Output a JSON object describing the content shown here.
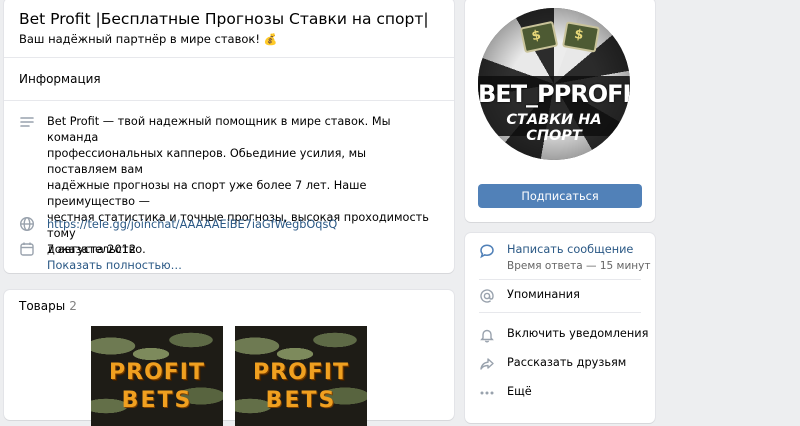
{
  "header": {
    "group_name": "Bet Profit |Бесплатные Прогнозы Ставки на спорт|",
    "status": "Ваш надёжный партнёр в мире ставок!",
    "status_emoji": "💰"
  },
  "info": {
    "section_title": "Информация",
    "description_lines": [
      "Bet Profit — твой надежный помощник в мире ставок. Мы команда",
      "профессиональных капперов. Обьединие усилия, мы поставляем вам",
      "надёжные прогнозы на спорт уже более 7 лет. Наше преимущество —",
      "честная статистика и точные прогнозы, высокая проходимость тому",
      "доказательство."
    ],
    "show_more": "Показать полностью…",
    "link": "https://tele.gg/joinchat/AAAAAEiBE7iaGfWegbOqsQ",
    "date": "7 августа 2012"
  },
  "goods": {
    "title": "Товары",
    "count": "2",
    "items": [
      {
        "line1": "PROFIT",
        "line2": "BETS"
      },
      {
        "line1": "PROFIT",
        "line2": "BETS"
      }
    ]
  },
  "avatar": {
    "brand": "BET_PPROFIT",
    "tagline": "СТАВКИ НА СПОРТ"
  },
  "subscribe": {
    "label": "Подписаться"
  },
  "actions": {
    "message_label": "Написать сообщение",
    "message_sub": "Время ответа — 15 минут",
    "mentions_label": "Упоминания",
    "notify_label": "Включить уведомления",
    "share_label": "Рассказать друзьям",
    "more_label": "Ещё"
  },
  "colors": {
    "background": "#edeef0",
    "accent": "#5181b8",
    "link": "#2a5885",
    "icon": "#99a2ad"
  }
}
